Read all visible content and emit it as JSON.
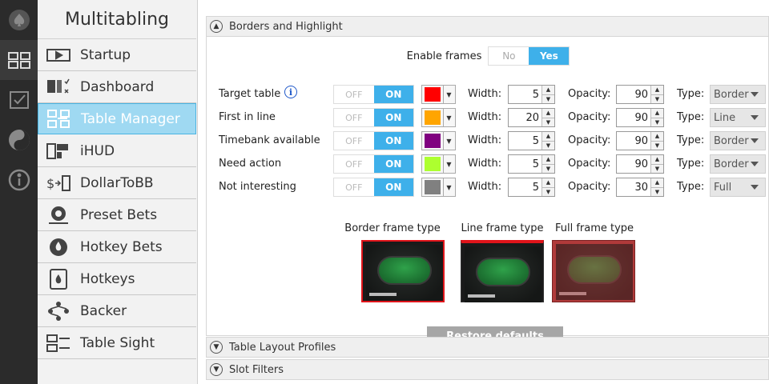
{
  "rail": {
    "items": [
      {
        "icon": "spade-logo-icon"
      },
      {
        "icon": "multitabling-grid-icon"
      },
      {
        "icon": "checkbox-icon"
      },
      {
        "icon": "yin-yang-icon"
      },
      {
        "icon": "info-icon"
      }
    ]
  },
  "sidebar": {
    "title": "Multitabling",
    "items": [
      {
        "label": "Startup",
        "icon": "video-icon"
      },
      {
        "label": "Dashboard",
        "icon": "dashboard-icon"
      },
      {
        "label": "Table Manager",
        "icon": "table-manager-icon",
        "active": true
      },
      {
        "label": "iHUD",
        "icon": "ihud-icon"
      },
      {
        "label": "DollarToBB",
        "icon": "dollar-to-bb-icon"
      },
      {
        "label": "Preset Bets",
        "icon": "chip-icon"
      },
      {
        "label": "Hotkey Bets",
        "icon": "hotkey-bets-icon"
      },
      {
        "label": "Hotkeys",
        "icon": "flame-icon"
      },
      {
        "label": "Backer",
        "icon": "backer-icon"
      },
      {
        "label": "Table Sight",
        "icon": "table-sight-icon"
      }
    ]
  },
  "sections": {
    "borders": {
      "title": "Borders and Highlight",
      "expanded": true
    },
    "layout_profiles": {
      "title": "Table Layout Profiles"
    },
    "slot_filters": {
      "title": "Slot Filters"
    }
  },
  "enable_frames": {
    "label": "Enable frames",
    "no": "No",
    "yes": "Yes",
    "selected": "Yes"
  },
  "field_labels": {
    "width": "Width:",
    "opacity": "Opacity:",
    "type": "Type:"
  },
  "toggle_labels": {
    "off": "OFF",
    "on": "ON"
  },
  "rows": [
    {
      "label": "Target table",
      "color": "#ff0000",
      "width": "5",
      "opacity": "90",
      "type": "Border",
      "info": true
    },
    {
      "label": "First in line",
      "color": "#ffa500",
      "width": "20",
      "opacity": "90",
      "type": "Line"
    },
    {
      "label": "Timebank available",
      "color": "#800080",
      "width": "5",
      "opacity": "90",
      "type": "Border"
    },
    {
      "label": "Need action",
      "color": "#adff2f",
      "width": "5",
      "opacity": "90",
      "type": "Border"
    },
    {
      "label": "Not interesting",
      "color": "#808080",
      "width": "5",
      "opacity": "30",
      "type": "Full"
    }
  ],
  "previews": [
    {
      "caption": "Border frame type",
      "color": "#e0141a"
    },
    {
      "caption": "Line frame type",
      "color": "#e0141a"
    },
    {
      "caption": "Full frame type",
      "color": "#b03a3a"
    }
  ],
  "restore_label": "Restore defaults"
}
